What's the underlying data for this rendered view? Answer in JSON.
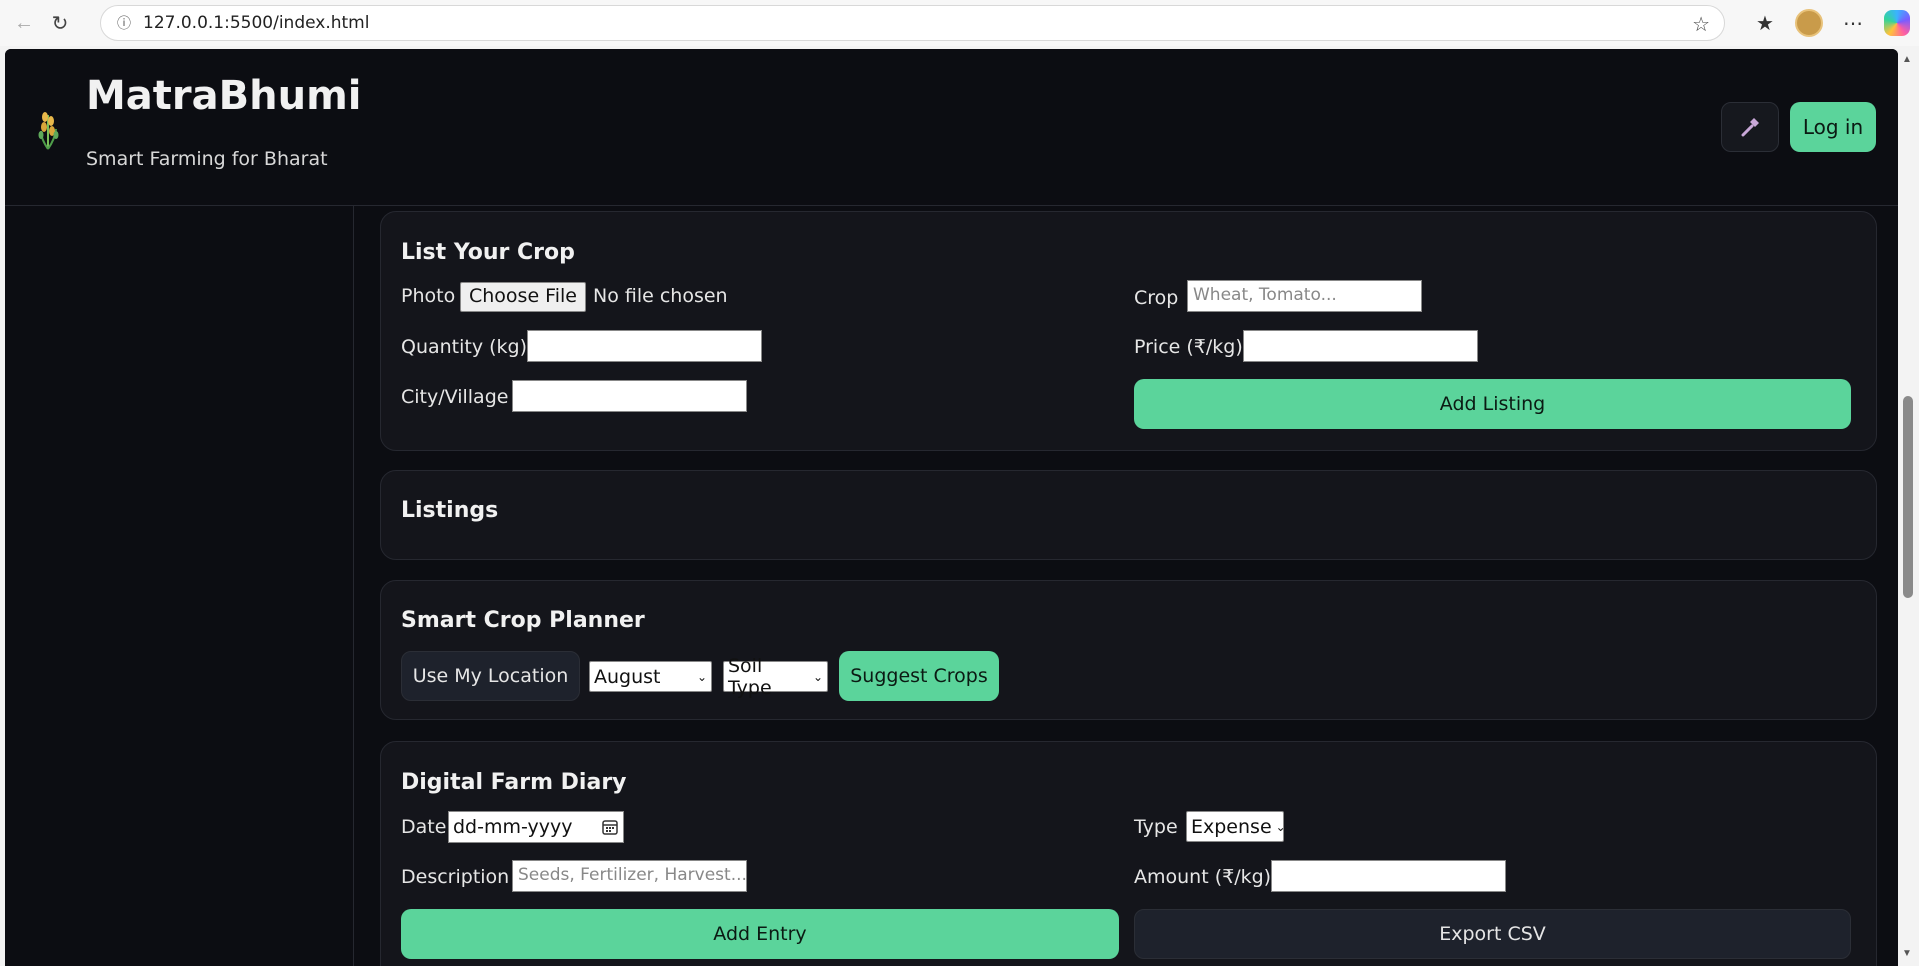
{
  "browser": {
    "url": "127.0.0.1:5500/index.html"
  },
  "header": {
    "title": "MatraBhumi",
    "subtitle": "Smart Farming for Bharat",
    "login_label": "Log in"
  },
  "list_crop": {
    "title": "List Your Crop",
    "photo_label": "Photo",
    "choose_file_label": "Choose File",
    "file_status": "No file chosen",
    "crop_label": "Crop",
    "crop_placeholder": "Wheat, Tomato...",
    "quantity_label": "Quantity (kg)",
    "quantity_value": "",
    "price_label": "Price (₹/kg)",
    "price_value": "",
    "city_label": "City/Village",
    "city_value": "",
    "add_listing_label": "Add Listing"
  },
  "listings": {
    "title": "Listings"
  },
  "crop_planner": {
    "title": "Smart Crop Planner",
    "use_location_label": "Use My Location",
    "month_selected": "August",
    "soil_selected": "Soil Type",
    "suggest_label": "Suggest Crops"
  },
  "farm_diary": {
    "title": "Digital Farm Diary",
    "date_label": "Date",
    "date_placeholder": "dd-mm-yyyy",
    "type_label": "Type",
    "type_selected": "Expense",
    "description_label": "Description",
    "description_placeholder": "Seeds, Fertilizer, Harvest...",
    "amount_label": "Amount (₹/kg)",
    "amount_value": "",
    "add_entry_label": "Add Entry",
    "export_label": "Export CSV"
  },
  "colors": {
    "accent": "#5bd49b",
    "background": "#0c0d12",
    "card": "#14151b"
  }
}
